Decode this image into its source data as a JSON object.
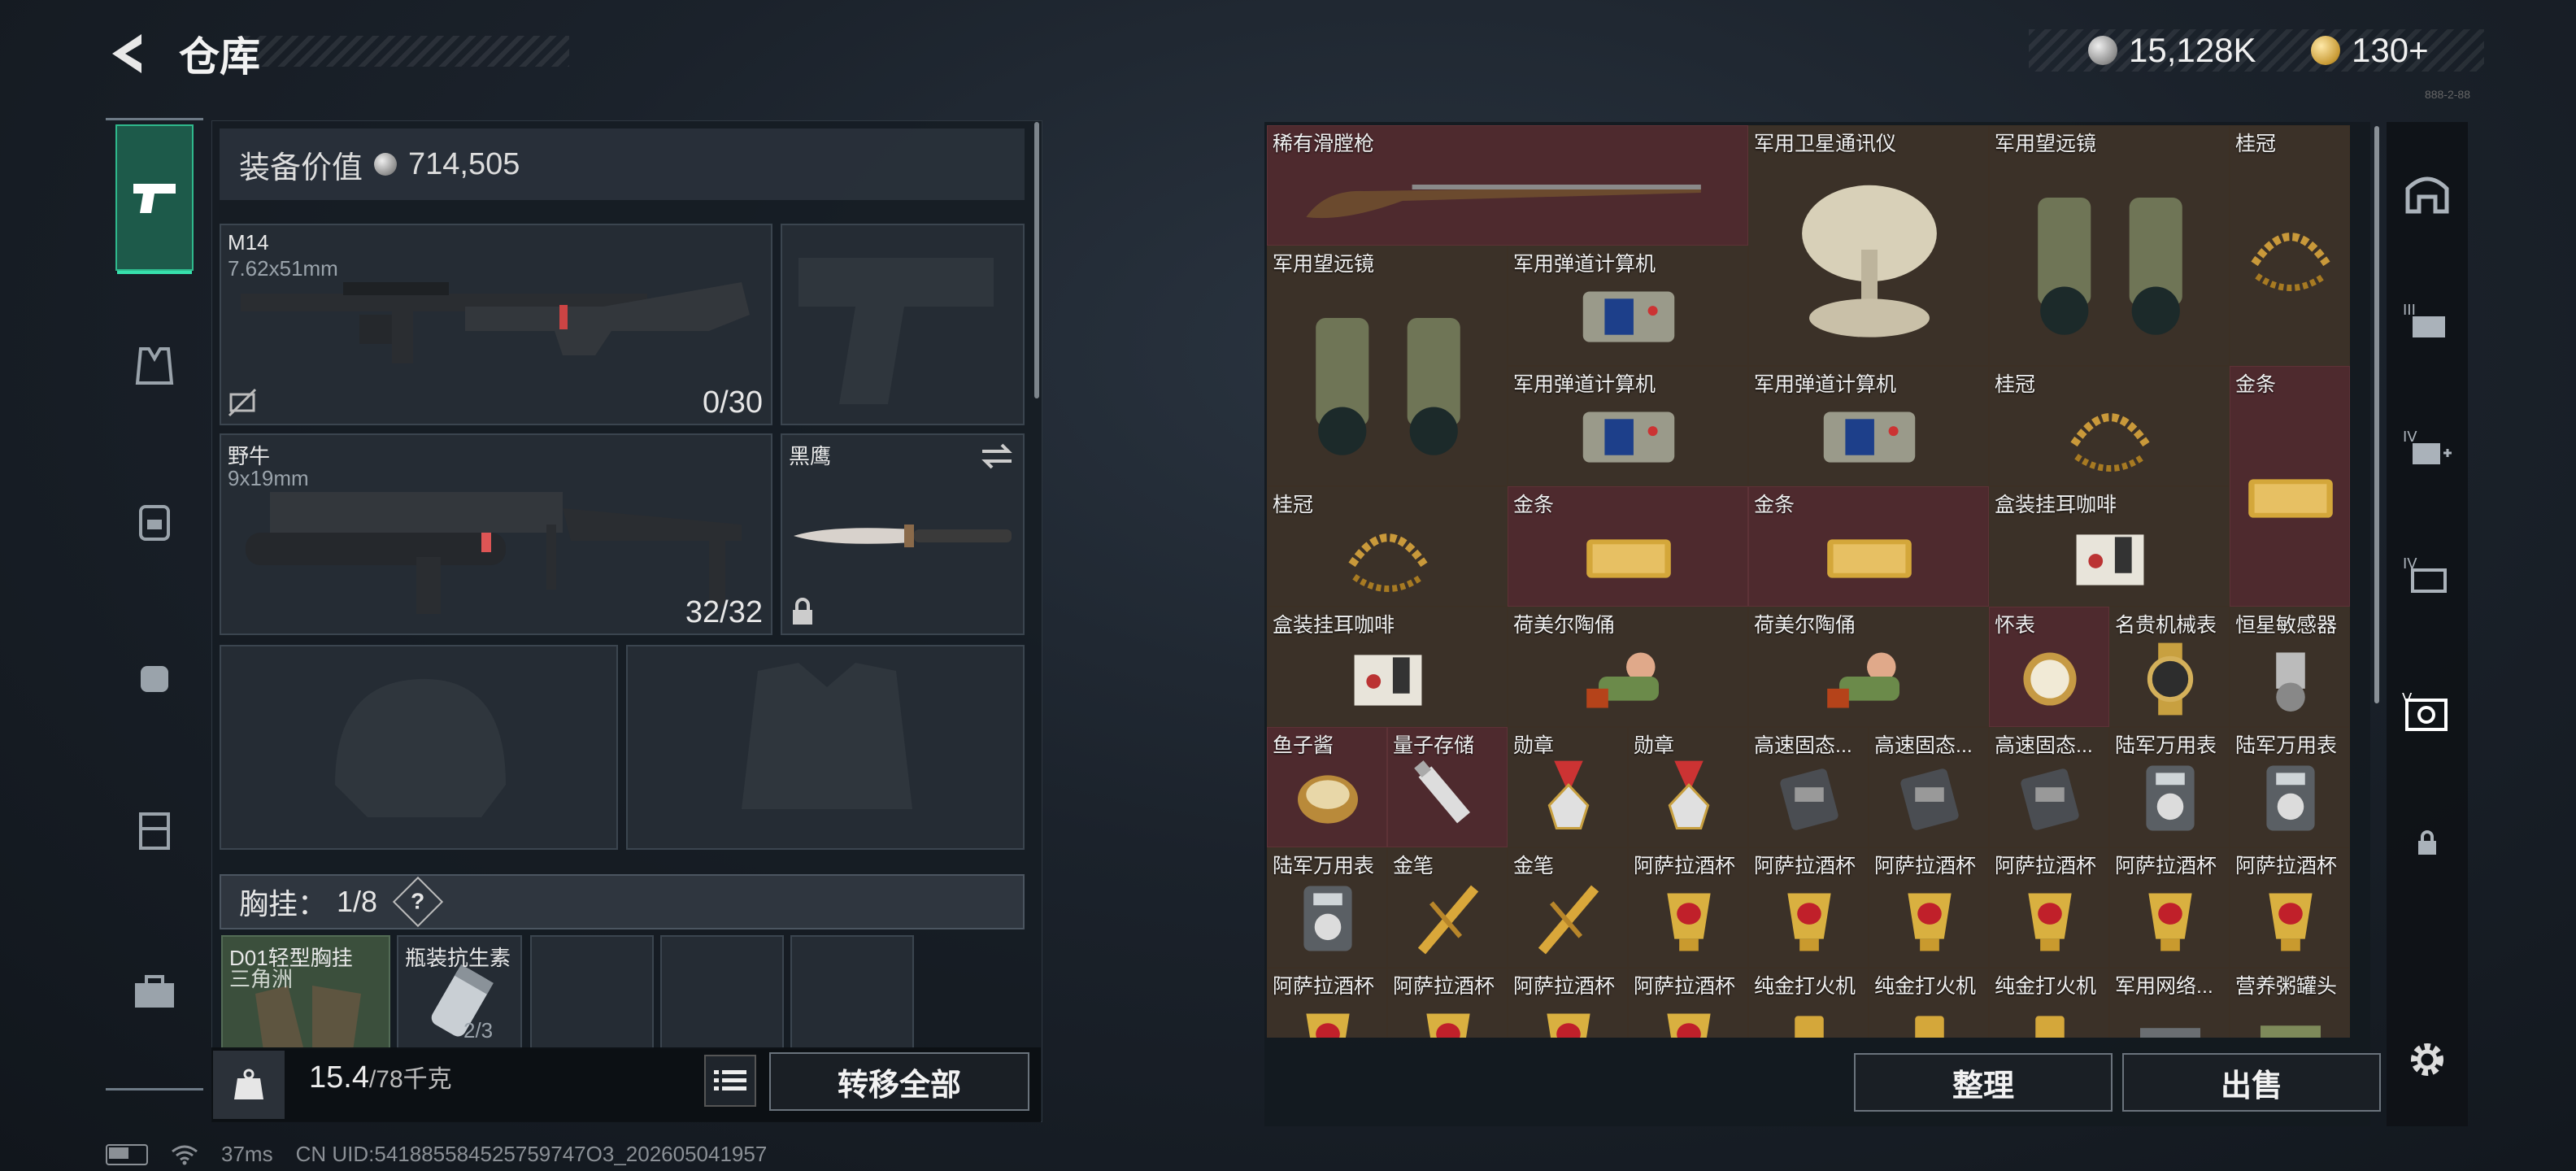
{
  "header": {
    "title": "仓库",
    "currency_silver": "15,128K",
    "currency_gold": "130+",
    "version": "888-2-88"
  },
  "left_panel": {
    "equip_value_label": "装备价值",
    "equip_value": "714,505",
    "primary": {
      "name": "M14",
      "caliber": "7.62x51mm",
      "ammo": "0/30"
    },
    "secondary": {
      "name": "野牛",
      "caliber": "9x19mm",
      "ammo": "32/32"
    },
    "melee": {
      "name": "黑鹰"
    },
    "chest": {
      "label": "胸挂：",
      "count": "1/8",
      "help": "?"
    },
    "items": [
      {
        "name": "D01轻型胸挂",
        "sub": "三角洲"
      },
      {
        "name": "瓶装抗生素",
        "count": "2/3"
      }
    ],
    "weight": "15.4",
    "weight_max": "/78千克",
    "transfer_all": "转移全部"
  },
  "stash": {
    "cells": [
      {
        "label": "稀有滑膛枪",
        "icon": "musket",
        "tone": "red"
      },
      {
        "label": "军用卫星通讯仪",
        "icon": "satellite",
        "tone": "brown"
      },
      {
        "label": "军用望远镜",
        "icon": "binoculars",
        "tone": "brown"
      },
      {
        "label": "桂冠",
        "icon": "laurel",
        "tone": "brown"
      },
      {
        "label": "军用望远镜",
        "icon": "binoculars",
        "tone": "brown"
      },
      {
        "label": "军用弹道计算机",
        "icon": "calculator",
        "tone": "brown"
      },
      {
        "label": "军用弹道计算机",
        "icon": "calculator",
        "tone": "brown"
      },
      {
        "label": "军用弹道计算机",
        "icon": "calculator",
        "tone": "brown"
      },
      {
        "label": "桂冠",
        "icon": "laurel",
        "tone": "brown"
      },
      {
        "label": "金条",
        "icon": "gold-bar",
        "tone": "red"
      },
      {
        "label": "桂冠",
        "icon": "laurel",
        "tone": "brown"
      },
      {
        "label": "金条",
        "icon": "gold-bar",
        "tone": "red"
      },
      {
        "label": "金条",
        "icon": "gold-bar",
        "tone": "red"
      },
      {
        "label": "盒装挂耳咖啡",
        "icon": "coffee-box",
        "tone": "brown"
      },
      {
        "label": "盒装挂耳咖啡",
        "icon": "coffee-box",
        "tone": "brown"
      },
      {
        "label": "荷美尔陶俑",
        "icon": "figurine",
        "tone": "brown"
      },
      {
        "label": "荷美尔陶俑",
        "icon": "figurine",
        "tone": "brown"
      },
      {
        "label": "怀表",
        "icon": "pocket-watch",
        "tone": "red"
      },
      {
        "label": "名贵机械表",
        "icon": "watch",
        "tone": "brown"
      },
      {
        "label": "恒星敏感器",
        "icon": "sensor",
        "tone": "brown"
      },
      {
        "label": "鱼子酱",
        "icon": "caviar",
        "tone": "red"
      },
      {
        "label": "量子存储",
        "icon": "usb",
        "tone": "red"
      },
      {
        "label": "勋章",
        "icon": "medal",
        "tone": "brown"
      },
      {
        "label": "勋章",
        "icon": "medal",
        "tone": "brown"
      },
      {
        "label": "高速固态...",
        "icon": "ssd",
        "tone": "brown"
      },
      {
        "label": "高速固态...",
        "icon": "ssd",
        "tone": "brown"
      },
      {
        "label": "高速固态...",
        "icon": "ssd",
        "tone": "brown"
      },
      {
        "label": "陆军万用表",
        "icon": "multimeter",
        "tone": "brown"
      },
      {
        "label": "陆军万用表",
        "icon": "multimeter",
        "tone": "brown"
      },
      {
        "label": "陆军万用表",
        "icon": "multimeter",
        "tone": "brown"
      },
      {
        "label": "金笔",
        "icon": "pen",
        "tone": "brown"
      },
      {
        "label": "金笔",
        "icon": "pen",
        "tone": "brown"
      },
      {
        "label": "阿萨拉酒杯",
        "icon": "cup",
        "tone": "brown"
      },
      {
        "label": "阿萨拉酒杯",
        "icon": "cup",
        "tone": "brown"
      },
      {
        "label": "阿萨拉酒杯",
        "icon": "cup",
        "tone": "brown"
      },
      {
        "label": "阿萨拉酒杯",
        "icon": "cup",
        "tone": "brown"
      },
      {
        "label": "阿萨拉酒杯",
        "icon": "cup",
        "tone": "brown"
      },
      {
        "label": "阿萨拉酒杯",
        "icon": "cup",
        "tone": "brown"
      },
      {
        "label": "阿萨拉酒杯",
        "icon": "cup",
        "tone": "brown"
      },
      {
        "label": "阿萨拉酒杯",
        "icon": "cup",
        "tone": "brown"
      },
      {
        "label": "阿萨拉酒杯",
        "icon": "cup",
        "tone": "brown"
      },
      {
        "label": "阿萨拉酒杯",
        "icon": "cup",
        "tone": "brown"
      },
      {
        "label": "纯金打火机",
        "icon": "lighter",
        "tone": "brown"
      },
      {
        "label": "纯金打火机",
        "icon": "lighter",
        "tone": "brown"
      },
      {
        "label": "纯金打火机",
        "icon": "lighter",
        "tone": "brown"
      },
      {
        "label": "军用网络...",
        "icon": "network",
        "tone": "brown"
      },
      {
        "label": "营养粥罐头",
        "icon": "can",
        "tone": "brown"
      }
    ],
    "organize": "整理",
    "sell": "出售"
  },
  "footer": {
    "ping": "37ms",
    "uid": "CN UID:541885584525759747O3_202605041957"
  },
  "colors": {
    "accent": "#2fb98c",
    "red_cell": "#4e2a2e",
    "brown_cell": "#3b3128"
  }
}
